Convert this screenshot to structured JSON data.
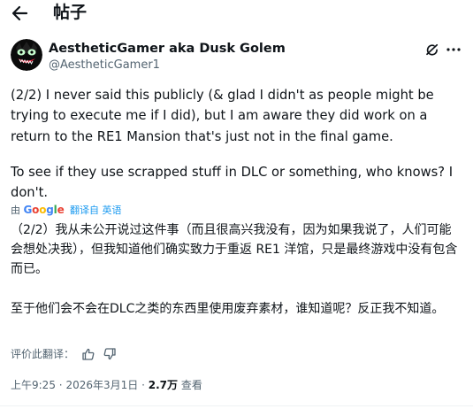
{
  "header": {
    "title": "帖子"
  },
  "author": {
    "display_name": "AestheticGamer aka Dusk Golem",
    "handle": "@AestheticGamer1"
  },
  "tweet": {
    "paragraph1": "(2/2) I never said this publicly (& glad I didn't as people might be trying to execute me if I did), but I am aware they did work on a return to the RE1 Mansion that's just not in the final game.",
    "paragraph2": "To see if they use scrapped stuff in DLC or something, who knows? I don't."
  },
  "translation_bar": {
    "by_label": "由",
    "google_label": "Google",
    "translated_from": "翻译自 英语"
  },
  "translation": {
    "paragraph1": "（2/2）我从未公开说过这件事（而且很高兴我没有，因为如果我说了，人们可能会想处决我），但我知道他们确实致力于重返 RE1 洋馆，只是最终游戏中没有包含而已。",
    "paragraph2": "至于他们会不会在DLC之类的东西里使用废弃素材，谁知道呢？反正我不知道。"
  },
  "rate_translation": {
    "label": "评价此翻译："
  },
  "meta": {
    "time": "上午9:25",
    "separator": "·",
    "date": "2026年3月1日",
    "views_count": "2.7万",
    "views_label": "查看"
  },
  "colors": {
    "accent": "#1d9bf0",
    "secondary_text": "#536471",
    "text": "#0f1419"
  }
}
